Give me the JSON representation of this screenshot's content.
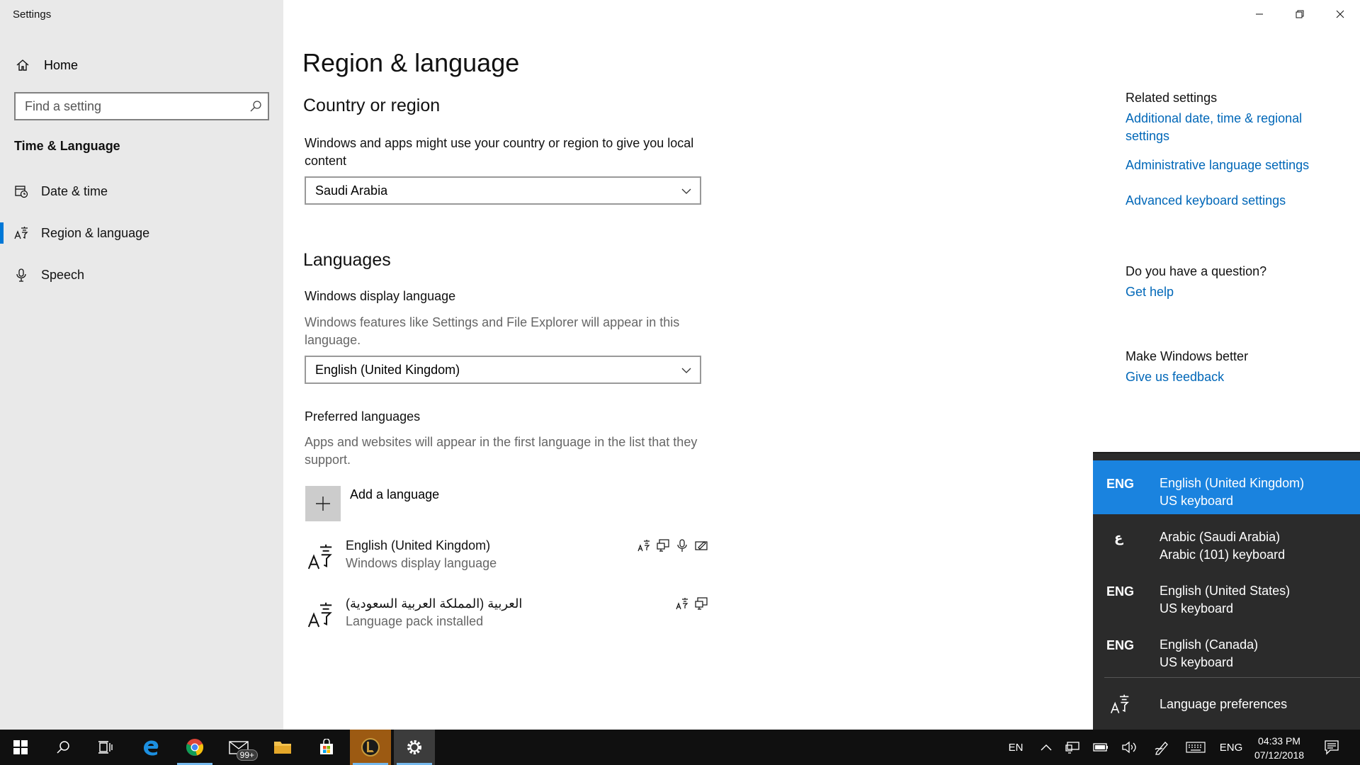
{
  "window": {
    "title": "Settings",
    "controls": {
      "minimize_icon": "minimize-icon",
      "maximize_icon": "restore-icon",
      "close_icon": "close-icon"
    }
  },
  "sidebar": {
    "home_label": "Home",
    "search_placeholder": "Find a setting",
    "section_title": "Time & Language",
    "items": [
      {
        "label": "Date & time",
        "icon": "calendar-clock-icon"
      },
      {
        "label": "Region & language",
        "icon": "language-icon",
        "active": true
      },
      {
        "label": "Speech",
        "icon": "microphone-icon"
      }
    ]
  },
  "main": {
    "page_title": "Region & language",
    "country": {
      "heading": "Country or region",
      "description": "Windows and apps might use your country or region to give you local content",
      "selected": "Saudi Arabia"
    },
    "languages": {
      "heading": "Languages",
      "display_heading": "Windows display language",
      "display_description": "Windows features like Settings and File Explorer will appear in this language.",
      "display_selected": "English (United Kingdom)",
      "preferred_heading": "Preferred languages",
      "preferred_description": "Apps and websites will appear in the first language in the list that they support.",
      "add_label": "Add a language",
      "list": [
        {
          "name": "English (United Kingdom)",
          "sub": "Windows display language",
          "features": [
            "language-pack-icon",
            "display-icon",
            "speech-icon",
            "handwriting-icon"
          ]
        },
        {
          "name": "العربية (المملكة العربية السعودية)",
          "sub": "Language pack installed",
          "features": [
            "language-pack-icon",
            "display-icon"
          ]
        }
      ]
    }
  },
  "related": {
    "heading": "Related settings",
    "links": [
      "Additional date, time & regional settings",
      "Administrative language settings",
      "Advanced keyboard settings"
    ],
    "question_heading": "Do you have a question?",
    "help_link": "Get help",
    "better_heading": "Make Windows better",
    "feedback_link": "Give us feedback"
  },
  "flyout": {
    "items": [
      {
        "abbr": "ENG",
        "language": "English (United Kingdom)",
        "keyboard": "US keyboard",
        "selected": true
      },
      {
        "abbr": "ع",
        "language": "Arabic (Saudi Arabia)",
        "keyboard": "Arabic (101) keyboard",
        "selected": false
      },
      {
        "abbr": "ENG",
        "language": "English (United States)",
        "keyboard": "US keyboard",
        "selected": false
      },
      {
        "abbr": "ENG",
        "language": "English (Canada)",
        "keyboard": "US keyboard",
        "selected": false
      }
    ],
    "preferences_label": "Language preferences",
    "selected_color": "#1a83df"
  },
  "taskbar": {
    "apps": [
      "start-icon",
      "search-icon",
      "task-view-icon",
      "edge-icon",
      "chrome-icon",
      "mail-icon",
      "file-explorer-icon",
      "store-icon",
      "league-of-legends-icon",
      "settings-icon"
    ],
    "mail_badge": "99+",
    "tray_lang": "EN",
    "input_indicator": "ENG",
    "time": "04:33 PM",
    "date": "07/12/2018"
  },
  "colors": {
    "accent": "#0078d7",
    "link": "#0067b8",
    "sidebar_bg": "#e9e9e9",
    "taskbar_bg": "#101010"
  }
}
